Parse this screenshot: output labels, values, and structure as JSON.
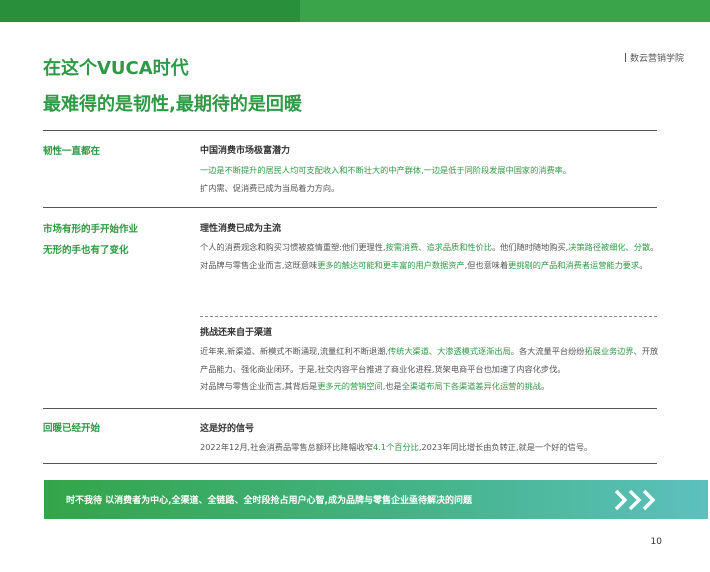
{
  "brand": {
    "name": "数云营销学院"
  },
  "title": {
    "line1": "在这个VUCA时代",
    "line2": "最难得的是韧性,最期待的是回暖"
  },
  "section1": {
    "label": "韧性一直都在",
    "heading": "中国消费市场极富潜力",
    "p1": "一边是不断提升的居民人均可支配收入和不断壮大的中产群体,一边是低于同阶段发展中国家的消费率。",
    "p2": "扩内需、促消费已成为当局着力方向。"
  },
  "section2": {
    "label_line1": "市场有形的手开始作业",
    "label_line2": "无形的手也有了变化",
    "block1": {
      "heading": "理性消费已成为主流",
      "p1": {
        "a": "个人的消费观念和购买习惯被疫情重塑:他们更理性,",
        "b": "按需消费、追求品质和性价比",
        "c": "。他们随时随地购买,",
        "d": "决策路径被细化、分散",
        "e": "。"
      },
      "p2": {
        "a": "对品牌与零售企业而言,这既意味",
        "b": "更多的触达可能和更丰富的用户数据资产",
        "c": ",但也意味着",
        "d": "更挑剔的产品和消费者运营能力要求",
        "e": "。"
      }
    },
    "block2": {
      "heading": "挑战还来自于渠道",
      "p1": {
        "a": "近年来,新渠道、新模式不断涌现,流量红利不断退潮,",
        "b": "传统大渠道、大渗透模式逐渐出局",
        "c": "。各大流量平台纷纷",
        "d": "拓展业务边界",
        "e": "、开放产品能力、强化商业闭环。于是,社交内容平台推进了商业化进程,货架电商平台也加速了内容化步伐。"
      },
      "p2": {
        "a": "对品牌与零售企业而言,其背后是",
        "b": "更多元的营销空间",
        "c": ",也是",
        "d": "全渠道布局下各渠道差异化运营的挑战",
        "e": "。"
      }
    }
  },
  "section3": {
    "label": "回暖已经开始",
    "heading": "这是好的信号",
    "p1": {
      "a": "2022年12月,社会消费品零售总额环比降幅收窄",
      "b": "4.1个百分比",
      "c": ",2023年同比增长由负转正,就是一个好的信号。"
    }
  },
  "banner": {
    "text": "时不我待  以消费者为中心,全渠道、全链路、全时段抢占用户心智,成为品牌与零售企业亟待解决的问题",
    "icon": "triple-chevron-right-icon"
  },
  "page_number": "10",
  "colors": {
    "accent": "#2f9a45",
    "bar": "#3aa44a",
    "banner_end": "#5cc1bd"
  }
}
